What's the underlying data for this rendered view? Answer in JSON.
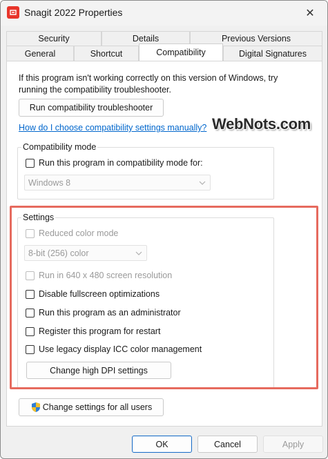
{
  "window": {
    "title": "Snagit 2022 Properties",
    "close_glyph": "✕"
  },
  "tabs": {
    "row1": [
      "Security",
      "Details",
      "Previous Versions"
    ],
    "row2": [
      "General",
      "Shortcut",
      "Compatibility",
      "Digital Signatures"
    ],
    "active": "Compatibility"
  },
  "intro": {
    "text": "If this program isn't working correctly on this version of Windows, try running the compatibility troubleshooter.",
    "troubleshooter_button": "Run compatibility troubleshooter",
    "help_link": "How do I choose compatibility settings manually?"
  },
  "watermark": "WebNots.com",
  "compat_mode": {
    "label": "Compatibility mode",
    "checkbox_label": "Run this program in compatibility mode for:",
    "selected_os": "Windows 8"
  },
  "settings": {
    "label": "Settings",
    "reduced_color": "Reduced color mode",
    "color_option": "8-bit (256) color",
    "resolution_640": "Run in 640 x 480 screen resolution",
    "disable_fullscreen": "Disable fullscreen optimizations",
    "run_as_admin": "Run this program as an administrator",
    "register_restart": "Register this program for restart",
    "legacy_icc": "Use legacy display ICC color management",
    "dpi_button": "Change high DPI settings"
  },
  "all_users_button": "Change settings for all users",
  "footer": {
    "ok": "OK",
    "cancel": "Cancel",
    "apply": "Apply"
  },
  "colors": {
    "highlight_border": "#e66a5e",
    "link": "#0066cc",
    "primary_border": "#1e6fc7",
    "app_icon": "#e8352b"
  }
}
